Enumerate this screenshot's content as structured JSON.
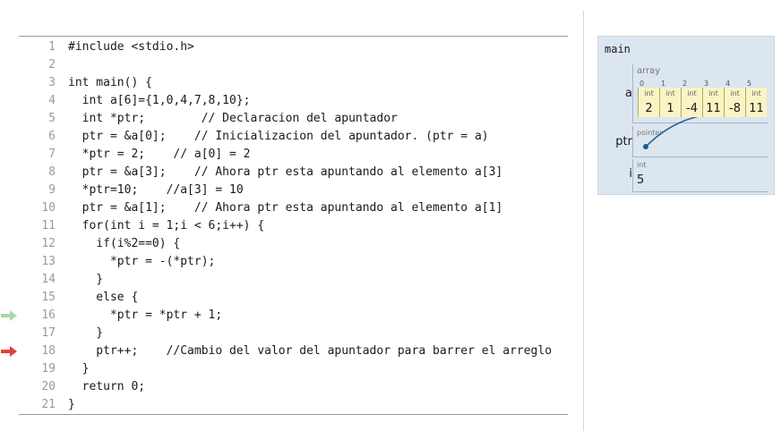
{
  "code": {
    "lines": [
      {
        "no": "1",
        "text": "#include <stdio.h>"
      },
      {
        "no": "2",
        "text": ""
      },
      {
        "no": "3",
        "text": "int main() {"
      },
      {
        "no": "4",
        "text": "  int a[6]={1,0,4,7,8,10};"
      },
      {
        "no": "5",
        "text": "  int *ptr;        // Declaracion del apuntador"
      },
      {
        "no": "6",
        "text": "  ptr = &a[0];    // Inicializacion del apuntador. (ptr = a)"
      },
      {
        "no": "7",
        "text": "  *ptr = 2;    // a[0] = 2"
      },
      {
        "no": "8",
        "text": "  ptr = &a[3];    // Ahora ptr esta apuntando al elemento a[3]"
      },
      {
        "no": "9",
        "text": "  *ptr=10;    //a[3] = 10"
      },
      {
        "no": "10",
        "text": "  ptr = &a[1];    // Ahora ptr esta apuntando al elemento a[1]"
      },
      {
        "no": "11",
        "text": "  for(int i = 1;i < 6;i++) {"
      },
      {
        "no": "12",
        "text": "    if(i%2==0) {"
      },
      {
        "no": "13",
        "text": "      *ptr = -(*ptr);"
      },
      {
        "no": "14",
        "text": "    }"
      },
      {
        "no": "15",
        "text": "    else {"
      },
      {
        "no": "16",
        "text": "      *ptr = *ptr + 1;"
      },
      {
        "no": "17",
        "text": "    }"
      },
      {
        "no": "18",
        "text": "    ptr++;    //Cambio del valor del apuntador para barrer el arreglo"
      },
      {
        "no": "19",
        "text": "  }"
      },
      {
        "no": "20",
        "text": "  return 0;"
      },
      {
        "no": "21",
        "text": "}"
      }
    ],
    "prev_line_arrow": {
      "line": "16",
      "color": "#a8d8a8",
      "icon": "light-green-arrow"
    },
    "next_line_arrow": {
      "line": "18",
      "color": "#e0403a",
      "icon": "red-arrow"
    }
  },
  "visualization": {
    "frame_title": "main",
    "variables": {
      "a": {
        "label": "a",
        "kind": "array",
        "indices": [
          "0",
          "1",
          "2",
          "3",
          "4",
          "5"
        ],
        "types": [
          "int",
          "int",
          "int",
          "int",
          "int",
          "int"
        ],
        "values": [
          "2",
          "1",
          "-4",
          "11",
          "-8",
          "11"
        ]
      },
      "ptr": {
        "label": "ptr",
        "kind": "pointer",
        "points_to_index": 5
      },
      "i": {
        "label": "i",
        "type": "int",
        "value": "5"
      }
    },
    "colors": {
      "frame_bg": "#dbe6f0",
      "array_cell_bg": "#faf4c4",
      "pointer_arrow": "#1f5a8a"
    }
  }
}
